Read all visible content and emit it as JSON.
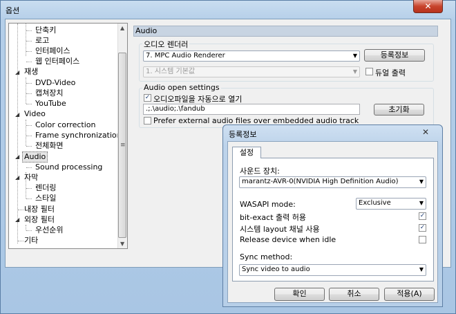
{
  "window": {
    "title": "옵션",
    "close_glyph": "✕"
  },
  "tree": [
    {
      "label": "단축키"
    },
    {
      "label": "로고"
    },
    {
      "label": "인터페이스"
    },
    {
      "label": "웹 인터페이스"
    },
    {
      "label": "재생"
    },
    {
      "label": "DVD-Video"
    },
    {
      "label": "캡쳐장치"
    },
    {
      "label": "YouTube"
    },
    {
      "label": "Video"
    },
    {
      "label": "Color correction"
    },
    {
      "label": "Frame synchronization"
    },
    {
      "label": "전체화면"
    },
    {
      "label": "Audio"
    },
    {
      "label": "Sound processing"
    },
    {
      "label": "자막"
    },
    {
      "label": "렌더링"
    },
    {
      "label": "스타일"
    },
    {
      "label": "내장 필터"
    },
    {
      "label": "외장 필터"
    },
    {
      "label": "우선순위"
    },
    {
      "label": "기타"
    }
  ],
  "panel": {
    "header": "Audio",
    "renderer_group": "오디오 렌더러",
    "renderer_value": "7. MPC Audio Renderer",
    "properties_button": "등록정보",
    "secondary_value": "1. 시스템 기본값",
    "dual_output_label": "듀얼 출력",
    "open_group": "Audio open settings",
    "auto_open_label": "오디오파일을 자동으로 열기",
    "path_value": ".;.\\audio;.\\fandub",
    "reset_button": "초기화",
    "prefer_external_label": "Prefer external audio files over embedded audio track"
  },
  "dialog": {
    "title": "등록정보",
    "close_glyph": "✕",
    "tab": "설정",
    "sound_device_label": "사운드 장치:",
    "sound_device_value": "marantz-AVR-0(NVIDIA High Definition Audio)",
    "wasapi_label": "WASAPI mode:",
    "wasapi_value": "Exclusive",
    "bitexact_label": "bit-exact 출력 허용",
    "layout_label": "시스템 layout 채널 사용",
    "release_label": "Release device when idle",
    "sync_label": "Sync method:",
    "sync_value": "Sync video to audio",
    "ok_button": "확인",
    "cancel_button": "취소",
    "apply_button": "적용(A)"
  },
  "checks": {
    "auto_open": true,
    "dual_output": false,
    "prefer_external": false,
    "bitexact": true,
    "layout": true,
    "release": false
  }
}
